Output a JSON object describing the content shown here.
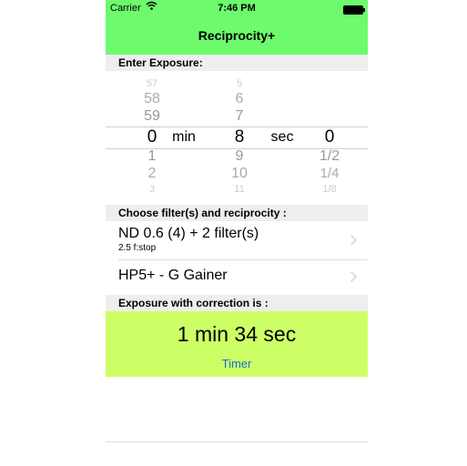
{
  "status_bar": {
    "carrier": "Carrier",
    "time": "7:46 PM"
  },
  "nav": {
    "title": "Reciprocity+"
  },
  "sections": {
    "enter_exposure": "Enter Exposure:",
    "choose_filters": "Choose filter(s) and reciprocity :",
    "exposure_correction": "Exposure with correction is :"
  },
  "picker": {
    "minutes": {
      "above": [
        "57",
        "58",
        "59"
      ],
      "selected": "0",
      "below": [
        "1",
        "2",
        "3"
      ]
    },
    "min_label": "min",
    "seconds": {
      "above": [
        "5",
        "6",
        "7"
      ],
      "selected": "8",
      "below": [
        "9",
        "10",
        "11"
      ]
    },
    "sec_label": "sec",
    "fraction": {
      "selected": "0",
      "below": [
        "1/2",
        "1/4",
        "1/8"
      ]
    }
  },
  "filters": {
    "filter_cell": {
      "title": "ND 0.6 (4) + 2 filter(s)",
      "subtitle": "2.5 f:stop"
    },
    "film_cell": {
      "title": "HP5+  - G Gainer"
    }
  },
  "result": {
    "value": "1 min 34 sec",
    "timer_label": "Timer"
  },
  "colors": {
    "nav_green": "#6dfa6d",
    "result_bg": "#ccff66",
    "link_blue": "#1a6fd6"
  }
}
